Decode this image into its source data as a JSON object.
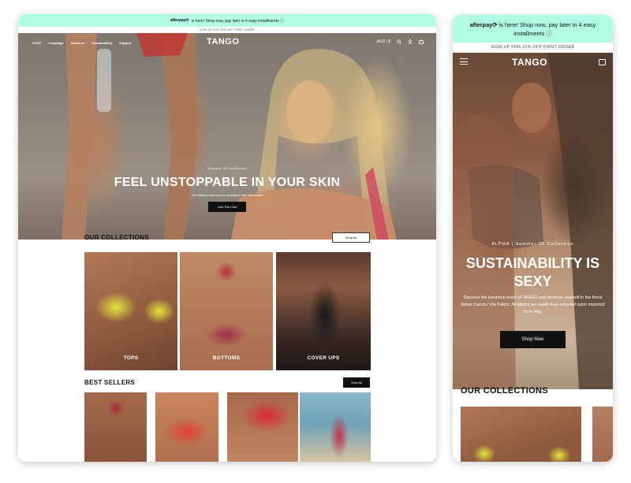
{
  "desktop": {
    "afterpay": {
      "logo": "afterpay⟳",
      "text": "is here! Shop now, pay later in 4 easy installments ⓘ"
    },
    "signup": "SIGN UP FOR 10% OFF FIRST ORDER",
    "nav": {
      "items": [
        "SHOP",
        "Campaign",
        "About us",
        "Sustainability",
        "Support"
      ],
      "brand": "TANGO",
      "currency": "AUD | $"
    },
    "hero": {
      "kicker": "Summer 25 collection",
      "title": "FEEL UNSTOPPABLE IN YOUR SKIN",
      "description": "The bikinis every local is obsessed with this season",
      "cta": "Join The Club"
    },
    "collections": {
      "heading": "OUR COLLECTIONS",
      "button": "Shop All",
      "cards": [
        "TOPS",
        "BOTTOMS",
        "COVER UPS"
      ]
    },
    "best_sellers": {
      "heading": "BEST SELLERS",
      "button": "View All"
    }
  },
  "mobile": {
    "afterpay": {
      "logo": "afterpay⟳",
      "text": "is here! Shop now, pay later in 4 easy installments ⓘ"
    },
    "signup": "SIGN UP FOR 10% OFF FIRST ORDER",
    "brand": "TANGO",
    "hero": {
      "kicker": "ALPHA | Summer 25 Collection",
      "title": "SUSTAINABILITY IS SEXY",
      "description": "Discover the luxurious touch of TANGO and immerse yourself in the finest Italian Carvico Vita Fabric. All fabrics are made from recycled nylon imported from Italy.",
      "cta": "Shop Now"
    },
    "collections_heading": "OUR COLLECTIONS"
  },
  "colors": {
    "afterpay_mint": "#b2fce4",
    "cta_black": "#111111",
    "text_white": "#ffffff"
  },
  "icons": [
    "search-icon",
    "account-icon",
    "cart-icon",
    "menu-icon"
  ]
}
